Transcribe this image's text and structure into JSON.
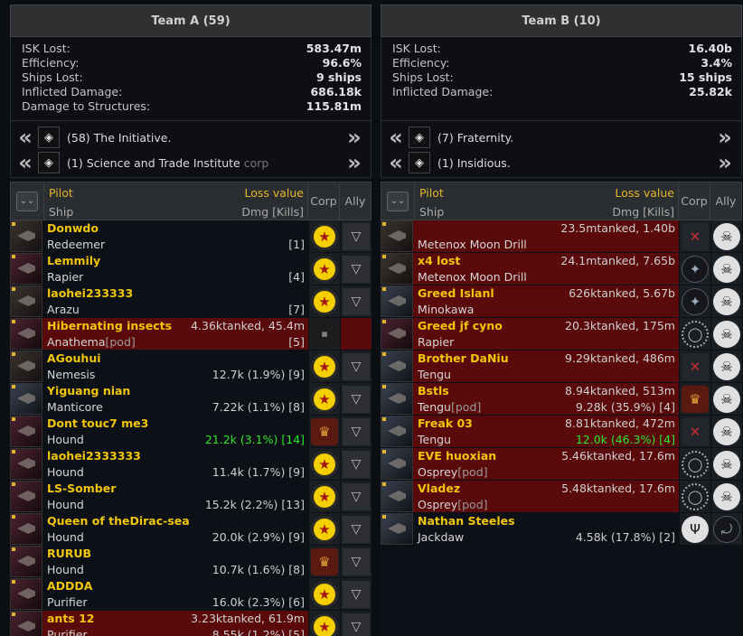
{
  "teamA": {
    "title": "Team A (59)",
    "stats": [
      {
        "label": "ISK Lost:",
        "value": "583.47m"
      },
      {
        "label": "Efficiency:",
        "value": "96.6%"
      },
      {
        "label": "Ships Lost:",
        "value": "9 ships"
      },
      {
        "label": "Inflicted Damage:",
        "value": "686.18k"
      },
      {
        "label": "Damage to Structures:",
        "value": "115.81m"
      }
    ],
    "entities": [
      {
        "count": "(58)",
        "name": "The Initiative.",
        "tag": "",
        "icon": "initiative-logo"
      },
      {
        "count": "(1)",
        "name": "Science and Trade Institute",
        "tag": "corp",
        "icon": "science-trade-logo"
      }
    ],
    "header": {
      "pilot": "Pilot",
      "loss": "Loss value",
      "ship": "Ship",
      "dmg": "Dmg [Kills]",
      "corp": "Corp",
      "ally": "Ally"
    },
    "rows": [
      {
        "pilot": "Donwdo",
        "ship": "Redeemer",
        "pod": "",
        "loss": "",
        "dmg": "[1]",
        "dmg_green": false,
        "lost": false,
        "corp": "star",
        "ally": "tri"
      },
      {
        "pilot": "Lemmily",
        "ship": "Rapier",
        "pod": "",
        "loss": "",
        "dmg": "[4]",
        "dmg_green": false,
        "lost": false,
        "corp": "star",
        "ally": "tri"
      },
      {
        "pilot": "laohei233333",
        "ship": "Arazu",
        "pod": "",
        "loss": "",
        "dmg": "[7]",
        "dmg_green": false,
        "lost": false,
        "corp": "star",
        "ally": "tri"
      },
      {
        "pilot": "Hibernating insects",
        "ship": "Anathema",
        "pod": "[pod]",
        "loss": "4.36ktanked, 45.4m",
        "dmg": "[5]",
        "dmg_green": false,
        "lost": true,
        "corp": "text",
        "ally": "blank"
      },
      {
        "pilot": "AGouhui",
        "ship": "Nemesis",
        "pod": "",
        "loss": "",
        "dmg": "12.7k (1.9%) [9]",
        "dmg_green": false,
        "lost": false,
        "corp": "star",
        "ally": "tri"
      },
      {
        "pilot": "Yiguang nian",
        "ship": "Manticore",
        "pod": "",
        "loss": "",
        "dmg": "7.22k (1.1%) [8]",
        "dmg_green": false,
        "lost": false,
        "corp": "star",
        "ally": "tri"
      },
      {
        "pilot": "Dont touc7 me3",
        "ship": "Hound",
        "pod": "",
        "loss": "",
        "dmg": "21.2k (3.1%) [14]",
        "dmg_green": true,
        "lost": false,
        "corp": "eagle",
        "ally": "tri"
      },
      {
        "pilot": "laohei2333333",
        "ship": "Hound",
        "pod": "",
        "loss": "",
        "dmg": "11.4k (1.7%) [9]",
        "dmg_green": false,
        "lost": false,
        "corp": "star",
        "ally": "tri"
      },
      {
        "pilot": "LS-Somber",
        "ship": "Hound",
        "pod": "",
        "loss": "",
        "dmg": "15.2k (2.2%) [13]",
        "dmg_green": false,
        "lost": false,
        "corp": "star",
        "ally": "tri"
      },
      {
        "pilot": "Queen of theDirac-sea",
        "ship": "Hound",
        "pod": "",
        "loss": "",
        "dmg": "20.0k (2.9%) [9]",
        "dmg_green": false,
        "lost": false,
        "corp": "star",
        "ally": "tri"
      },
      {
        "pilot": "RURUB",
        "ship": "Hound",
        "pod": "",
        "loss": "",
        "dmg": "10.7k (1.6%) [8]",
        "dmg_green": false,
        "lost": false,
        "corp": "eagle",
        "ally": "tri"
      },
      {
        "pilot": "ADDDA",
        "ship": "Purifier",
        "pod": "",
        "loss": "",
        "dmg": "16.0k (2.3%) [6]",
        "dmg_green": false,
        "lost": false,
        "corp": "star",
        "ally": "tri"
      },
      {
        "pilot": "ants 12",
        "ship": "Purifier",
        "pod": "",
        "loss": "3.23ktanked, 61.9m",
        "dmg": "8.55k (1.2%) [5]",
        "dmg_green": false,
        "lost": true,
        "corp": "star",
        "ally": "tri"
      }
    ]
  },
  "teamB": {
    "title": "Team B (10)",
    "stats": [
      {
        "label": "ISK Lost:",
        "value": "16.40b"
      },
      {
        "label": "Efficiency:",
        "value": "3.4%"
      },
      {
        "label": "Ships Lost:",
        "value": "15 ships"
      },
      {
        "label": "Inflicted Damage:",
        "value": "25.82k"
      }
    ],
    "entities": [
      {
        "count": "(7)",
        "name": "Fraternity.",
        "tag": "",
        "icon": "fraternity-logo"
      },
      {
        "count": "(1)",
        "name": "Insidious.",
        "tag": "",
        "icon": "insidious-logo"
      }
    ],
    "header": {
      "pilot": "Pilot",
      "loss": "Loss value",
      "ship": "Ship",
      "dmg": "Dmg [Kills]",
      "corp": "Corp",
      "ally": "Ally"
    },
    "rows": [
      {
        "pilot": "",
        "ship": "Metenox Moon Drill",
        "pod": "",
        "loss": "23.5mtanked, 1.40b",
        "dmg": "",
        "dmg_green": false,
        "lost": true,
        "corp": "cross",
        "ally": "skull"
      },
      {
        "pilot": "x4 lost",
        "ship": "Metenox Moon Drill",
        "pod": "",
        "loss": "24.1mtanked, 7.65b",
        "dmg": "",
        "dmg_green": false,
        "lost": true,
        "corp": "dark",
        "ally": "skull"
      },
      {
        "pilot": "Greed Islanl",
        "ship": "Minokawa",
        "pod": "",
        "loss": "626ktanked, 5.67b",
        "dmg": "",
        "dmg_green": false,
        "lost": true,
        "corp": "dark",
        "ally": "skull"
      },
      {
        "pilot": "Greed jf cyno",
        "ship": "Rapier",
        "pod": "",
        "loss": "20.3ktanked, 175m",
        "dmg": "",
        "dmg_green": false,
        "lost": true,
        "corp": "ring",
        "ally": "skull"
      },
      {
        "pilot": "Brother DaNiu",
        "ship": "Tengu",
        "pod": "",
        "loss": "9.29ktanked, 486m",
        "dmg": "",
        "dmg_green": false,
        "lost": true,
        "corp": "cross",
        "ally": "skull"
      },
      {
        "pilot": "Bstls",
        "ship": "Tengu",
        "pod": "[pod]",
        "loss": "8.94ktanked, 513m",
        "dmg": "9.28k (35.9%) [4]",
        "dmg_green": false,
        "dmg_kills_green": true,
        "lost": true,
        "corp": "eagle",
        "ally": "skull"
      },
      {
        "pilot": "Freak 03",
        "ship": "Tengu",
        "pod": "",
        "loss": "8.81ktanked, 472m",
        "dmg": "12.0k (46.3%) [4]",
        "dmg_green": true,
        "lost": true,
        "corp": "cross",
        "ally": "skull"
      },
      {
        "pilot": "EVE huoxian",
        "ship": "Osprey",
        "pod": "[pod]",
        "loss": "5.46ktanked, 17.6m",
        "dmg": "",
        "dmg_green": false,
        "lost": true,
        "corp": "ring",
        "ally": "skull"
      },
      {
        "pilot": "Vladez",
        "ship": "Osprey",
        "pod": "[pod]",
        "loss": "5.48ktanked, 17.6m",
        "dmg": "",
        "dmg_green": false,
        "lost": true,
        "corp": "ring",
        "ally": "skull"
      },
      {
        "pilot": "Nathan Steeles",
        "ship": "Jackdaw",
        "pod": "",
        "loss": "",
        "dmg": "4.58k (17.8%) [2]",
        "dmg_green": false,
        "lost": false,
        "corp": "trident",
        "ally": "insidious"
      }
    ]
  },
  "icons": {
    "arrow_left": "«",
    "arrow_right": "»",
    "collapse": "⌄"
  }
}
